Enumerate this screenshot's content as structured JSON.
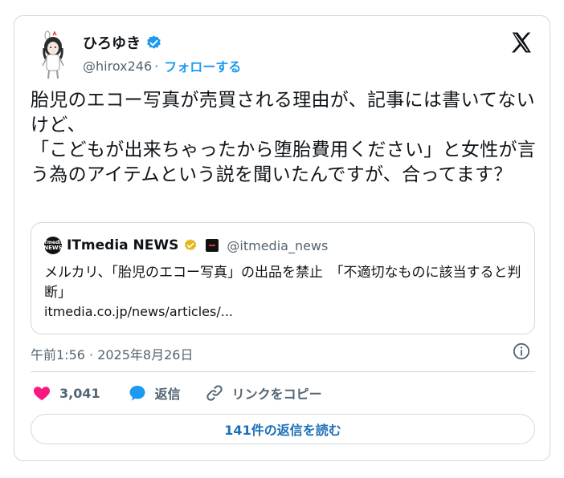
{
  "author": {
    "name": "ひろゆき",
    "handle": "@hirox246",
    "separator": "·",
    "follow_label": "フォローする",
    "verified": true
  },
  "tweet": {
    "text": "胎児のエコー写真が売買される理由が、記事には書いてないけど、\n「こどもが出来ちゃったから堕胎費用ください」と女性が言う為のアイテムという説を聞いたんですが、合ってます？"
  },
  "quote": {
    "logo_text": "ITmedia NEWS",
    "name": "ITmedia NEWS",
    "handle": "@itmedia_news",
    "title": "メルカリ、「胎児のエコー写真」の出品を禁止　「不適切なものに該当すると判断」",
    "url": "itmedia.co.jp/news/articles/..."
  },
  "timestamp": "午前1:56 · 2025年8月26日",
  "actions": {
    "like_count": "3,041",
    "reply_label": "返信",
    "copy_link_label": "リンクをコピー"
  },
  "read_replies_label": "141件の返信を読む",
  "colors": {
    "accent": "#1d9bf0",
    "like": "#f91880",
    "reply_icon": "#1d9bf0",
    "border": "#cfd9de",
    "muted_text": "#536471",
    "gold_badge": "#e2b719"
  },
  "icons": [
    "verified-badge-icon",
    "x-logo-icon",
    "gold-verified-icon",
    "info-icon",
    "heart-icon",
    "reply-bubble-icon",
    "link-icon"
  ]
}
